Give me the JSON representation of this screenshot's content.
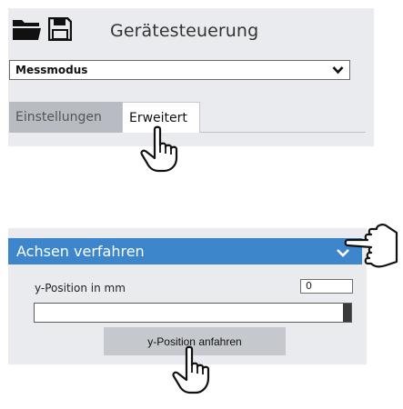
{
  "header": {
    "title": "Gerätesteuerung",
    "icons": [
      "folder-icon",
      "save-icon"
    ]
  },
  "mode_select": {
    "value": "Messmodus"
  },
  "tabs": [
    {
      "label": "Einstellungen",
      "active": false
    },
    {
      "label": "Erweitert",
      "active": true
    }
  ],
  "section": {
    "title": "Achsen verfahren",
    "y_label": "y-Position in mm",
    "y_value": "0",
    "slider_fraction": 1.0,
    "button_label": "y-Position anfahren"
  },
  "colors": {
    "panel_bg": "#e9ebee",
    "header_blue": "#3d86cc",
    "tab_inactive": "#b8bcc2",
    "button_bg": "#c5c8cd"
  }
}
